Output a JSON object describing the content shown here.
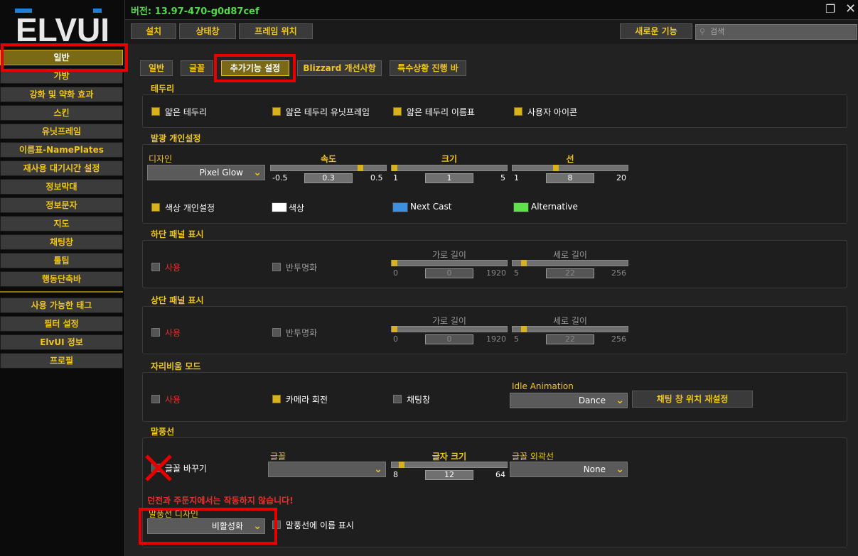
{
  "version_label": "버전: 13.97-470-g0d87cef",
  "logo_text": "ELVUI",
  "top_buttons": [
    "설치",
    "상태창",
    "프레임 위치"
  ],
  "new_features_label": "새로운 기능",
  "search_placeholder": "검색",
  "sidebar": [
    "일반",
    "가방",
    "강화 및 약화 효과",
    "스킨",
    "유닛프레임",
    "이름표-NamePlates",
    "재사용 대기시간 설정",
    "정보막대",
    "정보문자",
    "지도",
    "채팅창",
    "툴팁",
    "행동단축바"
  ],
  "sidebar_lower": [
    "사용 가능한 태그",
    "필터 설정",
    "ElvUI 정보",
    "프로필"
  ],
  "tabs": [
    "일반",
    "글꼴",
    "추가기능 설정",
    "Blizzard 개선사항",
    "특수상황 진행 바"
  ],
  "borders": {
    "title": "테두리",
    "options": [
      "얇은 테두리",
      "얇은 테두리 유닛프레임",
      "얇은 테두리 이름표",
      "사용자 아이콘"
    ]
  },
  "glow": {
    "title": "발광 개인설정",
    "design_label": "디자인",
    "design_value": "Pixel Glow",
    "speed": {
      "title": "속도",
      "min": "-0.5",
      "max": "0.5",
      "value": "0.3"
    },
    "size": {
      "title": "크기",
      "min": "1",
      "max": "5",
      "value": "1"
    },
    "line": {
      "title": "선",
      "min": "1",
      "max": "20",
      "value": "8"
    },
    "custom_color_label": "색상 개인설정",
    "color_label": "색상",
    "next_cast_label": "Next Cast",
    "alternative_label": "Alternative",
    "colors": {
      "color": "#ffffff",
      "next_cast": "#3d8fe0",
      "alternative": "#5ee34a"
    }
  },
  "bottom_panel": {
    "title": "하단 패널 표시",
    "enable_label": "사용",
    "transparent_label": "반투명화",
    "width": {
      "title": "가로 길이",
      "min": "0",
      "max": "1920",
      "value": "0"
    },
    "height": {
      "title": "세로 길이",
      "min": "5",
      "max": "256",
      "value": "22"
    }
  },
  "top_panel": {
    "title": "상단 패널 표시",
    "enable_label": "사용",
    "transparent_label": "반투명화",
    "width": {
      "title": "가로 길이",
      "min": "0",
      "max": "1920",
      "value": "0"
    },
    "height": {
      "title": "세로 길이",
      "min": "5",
      "max": "256",
      "value": "22"
    }
  },
  "afk": {
    "title": "자리비움 모드",
    "enable_label": "사용",
    "camera_label": "카메라 회전",
    "chat_label": "채팅창",
    "idle_label": "Idle Animation",
    "idle_value": "Dance",
    "reset_chat_label": "채팅 창 위치 재설정"
  },
  "bubbles": {
    "title": "말풍선",
    "replace_font_label": "글꼴 바꾸기",
    "font_label": "글꼴",
    "font_value": "",
    "font_size": {
      "title": "글자 크기",
      "min": "8",
      "max": "64",
      "value": "12"
    },
    "outline_label": "글꼴 외곽선",
    "outline_value": "None",
    "warning": "던전과 주둔지에서는 작동하지 않습니다!",
    "design_label": "말풍선 디자인",
    "design_value": "비활성화",
    "show_name_label": "말풍선에 이름 표시"
  }
}
